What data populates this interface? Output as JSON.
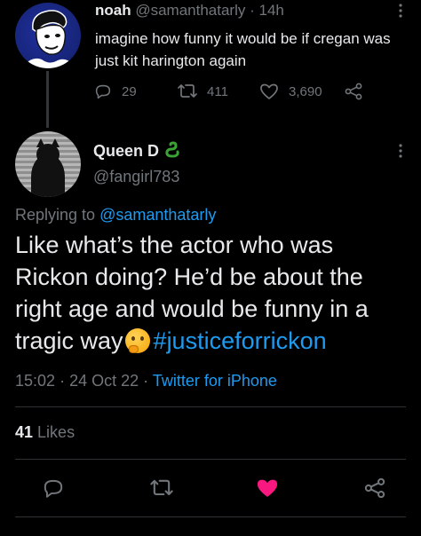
{
  "parent_tweet": {
    "name": "noah",
    "handle": "@samanthatarly",
    "separator": "·",
    "time": "14h",
    "text": "imagine how funny it would be if cregan was just kit harington again",
    "replies": "29",
    "retweets": "411",
    "likes": "3,690",
    "more_icon": "more-vertical-icon"
  },
  "main_tweet": {
    "name": "Queen D",
    "name_emoji": "snake-emoji",
    "handle": "@fangirl783",
    "replying_prefix": "Replying to",
    "replying_to": "@samanthatarly",
    "text_before_emoji": "Like what’s the actor who was Rickon doing? He’d be about the right age and would be funny in a tragic way",
    "hashtag": "#justiceforrickon",
    "time": "15:02",
    "date_separator": "·",
    "date": "24 Oct 22",
    "source_separator": "·",
    "source": "Twitter for iPhone",
    "likes_count": "41",
    "likes_label": "Likes"
  },
  "colors": {
    "background": "#000000",
    "text_primary": "#e7e9ea",
    "text_secondary": "#71767b",
    "link": "#1d9bf0",
    "like_active": "#f91880",
    "divider": "#2f3336"
  },
  "icons": [
    "reply-icon",
    "retweet-icon",
    "like-icon",
    "share-icon",
    "more-vertical-icon",
    "thinking-face-emoji",
    "snake-emoji"
  ]
}
